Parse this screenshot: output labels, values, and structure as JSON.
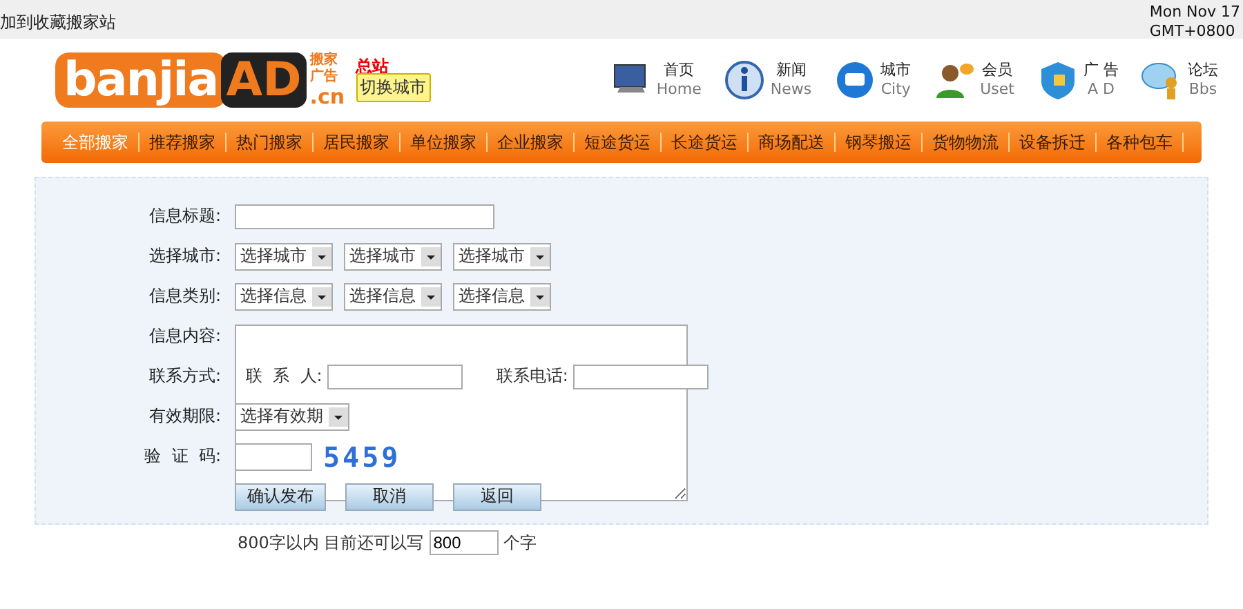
{
  "top_bar": {
    "bookmark_link": "加到收藏搬家站",
    "date_line_1": "Mon Nov 17",
    "date_line_2": "GMT+0800"
  },
  "logo": {
    "word": "banjia",
    "word_box": "AD",
    "side_top": "搬家",
    "side_mid": "广告",
    "side_bottom": ".cn",
    "station": "总站",
    "switch_city": "切换城市"
  },
  "header_links": [
    {
      "kind": "monitor",
      "title": "首页",
      "subtitle": "Home"
    },
    {
      "kind": "info",
      "title": "新闻",
      "subtitle": "News"
    },
    {
      "kind": "chat",
      "title": "城市",
      "subtitle": "City"
    },
    {
      "kind": "person",
      "title": "会员",
      "subtitle": "Uset"
    },
    {
      "kind": "shield",
      "title": "广 告",
      "subtitle": "A D"
    },
    {
      "kind": "bubble",
      "title": "论坛",
      "subtitle": "Bbs"
    }
  ],
  "nav": [
    {
      "label": "全部搬家",
      "selected": true
    },
    {
      "label": "推荐搬家",
      "selected": false
    },
    {
      "label": "热门搬家",
      "selected": false
    },
    {
      "label": "居民搬家",
      "selected": false
    },
    {
      "label": "单位搬家",
      "selected": false
    },
    {
      "label": "企业搬家",
      "selected": false
    },
    {
      "label": "短途货运",
      "selected": false
    },
    {
      "label": "长途货运",
      "selected": false
    },
    {
      "label": "商场配送",
      "selected": false
    },
    {
      "label": "钢琴搬运",
      "selected": false
    },
    {
      "label": "货物物流",
      "selected": false
    },
    {
      "label": "设备拆迁",
      "selected": false
    },
    {
      "label": "各种包车",
      "selected": false
    }
  ],
  "form": {
    "title_label": "信息标题:",
    "city_label": "选择城市:",
    "city_selects": [
      "选择城市",
      "选择城市",
      "选择城市"
    ],
    "category_label": "信息类别:",
    "category_selects": [
      "选择信息",
      "选择信息",
      "选择信息"
    ],
    "content_label": "信息内容:",
    "contact_label": "联系方式:",
    "contact_person_label": "联  系  人:",
    "contact_phone_label": "联系电话:",
    "validity_label": "有效期限:",
    "validity_select": "选择有效期",
    "captcha_label": "验  证  码:",
    "captcha_code": "5459",
    "buttons": [
      "确认发布",
      "取消",
      "返回"
    ]
  },
  "counter": {
    "prefix": "800字以内 目前还可以写",
    "value": "800",
    "suffix": "个字"
  }
}
